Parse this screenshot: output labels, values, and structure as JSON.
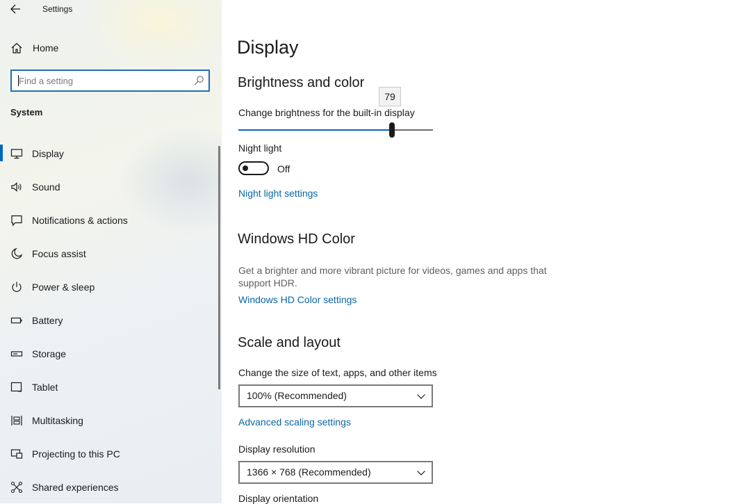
{
  "titlebar": {
    "title": "Settings",
    "back_icon": "back-arrow-icon"
  },
  "sidebar": {
    "home_label": "Home",
    "search": {
      "placeholder": "Find a setting",
      "value": ""
    },
    "section_header": "System",
    "items": [
      {
        "label": "Display",
        "icon": "monitor-icon",
        "active": true
      },
      {
        "label": "Sound",
        "icon": "speaker-icon"
      },
      {
        "label": "Notifications & actions",
        "icon": "notification-icon"
      },
      {
        "label": "Focus assist",
        "icon": "moon-icon"
      },
      {
        "label": "Power & sleep",
        "icon": "power-icon"
      },
      {
        "label": "Battery",
        "icon": "battery-icon"
      },
      {
        "label": "Storage",
        "icon": "storage-icon"
      },
      {
        "label": "Tablet",
        "icon": "tablet-icon"
      },
      {
        "label": "Multitasking",
        "icon": "multitasking-icon"
      },
      {
        "label": "Projecting to this PC",
        "icon": "projecting-icon"
      },
      {
        "label": "Shared experiences",
        "icon": "shared-experiences-icon"
      }
    ]
  },
  "main": {
    "title": "Display",
    "brightness": {
      "heading": "Brightness and color",
      "slider_label": "Change brightness for the built-in display",
      "value": 79,
      "value_text": "79",
      "max": 100
    },
    "night_light": {
      "label": "Night light",
      "state": "Off",
      "settings_link": "Night light settings"
    },
    "hd_color": {
      "heading": "Windows HD Color",
      "description": "Get a brighter and more vibrant picture for videos, games and apps that support HDR.",
      "settings_link": "Windows HD Color settings"
    },
    "scale": {
      "heading": "Scale and layout",
      "size_label": "Change the size of text, apps, and other items",
      "size_value": "100% (Recommended)",
      "advanced_link": "Advanced scaling settings",
      "resolution_label": "Display resolution",
      "resolution_value": "1366 × 768 (Recommended)",
      "orientation_label": "Display orientation"
    }
  },
  "colors": {
    "accent": "#0067c0",
    "link": "#0a66a3"
  }
}
